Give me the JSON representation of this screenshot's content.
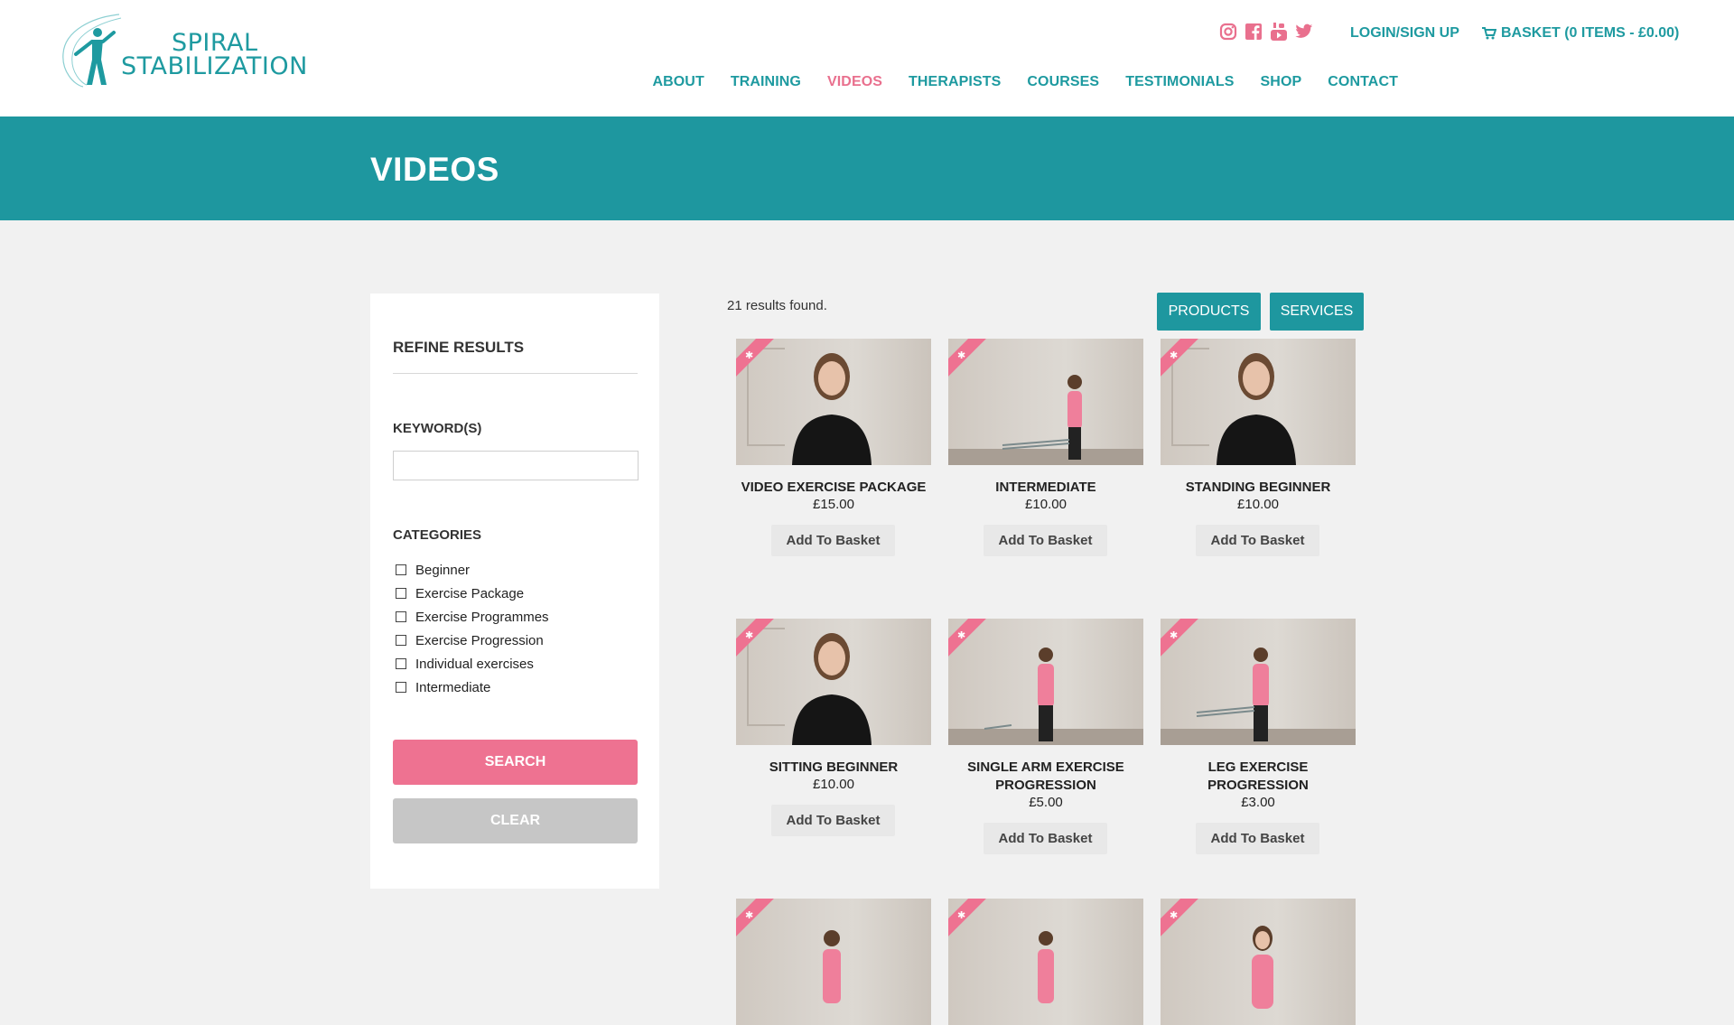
{
  "header": {
    "logo_line1": "SPIRAL",
    "logo_line2": "STABILIZATION",
    "social": [
      "instagram-icon",
      "facebook-icon",
      "youtube-icon",
      "twitter-icon"
    ],
    "login_label": "LOGIN/SIGN UP",
    "basket_label": "BASKET (0 ITEMS - £0.00)",
    "nav": [
      {
        "label": "ABOUT"
      },
      {
        "label": "TRAINING"
      },
      {
        "label": "VIDEOS"
      },
      {
        "label": "THERAPISTS"
      },
      {
        "label": "COURSES"
      },
      {
        "label": "TESTIMONIALS"
      },
      {
        "label": "SHOP"
      },
      {
        "label": "CONTACT"
      }
    ],
    "active_nav": "VIDEOS",
    "colors": {
      "brand": "#1e9aa0",
      "accent": "#e9708e"
    }
  },
  "banner": {
    "title": "VIDEOS"
  },
  "sidebar": {
    "title": "REFINE RESULTS",
    "keyword_label": "KEYWORD(S)",
    "keyword_value": "",
    "categories_label": "CATEGORIES",
    "categories": [
      {
        "label": "Beginner",
        "checked": false
      },
      {
        "label": "Exercise Package",
        "checked": false
      },
      {
        "label": "Exercise Programmes",
        "checked": false
      },
      {
        "label": "Exercise Progression",
        "checked": false
      },
      {
        "label": "Individual exercises",
        "checked": false
      },
      {
        "label": "Intermediate",
        "checked": false
      }
    ],
    "search_label": "SEARCH",
    "clear_label": "CLEAR"
  },
  "results": {
    "count_text": "21 results found.",
    "products_label": "PRODUCTS",
    "services_label": "SERVICES",
    "add_label": "Add To Basket",
    "items": [
      {
        "title": "VIDEO EXERCISE PACKAGE",
        "price": "£15.00"
      },
      {
        "title": "INTERMEDIATE",
        "price": "£10.00"
      },
      {
        "title": "STANDING BEGINNER",
        "price": "£10.00"
      },
      {
        "title": "SITTING BEGINNER",
        "price": "£10.00"
      },
      {
        "title": "SINGLE ARM EXERCISE PROGRESSION",
        "price": "£5.00"
      },
      {
        "title": "LEG EXERCISE PROGRESSION",
        "price": "£3.00"
      }
    ]
  }
}
